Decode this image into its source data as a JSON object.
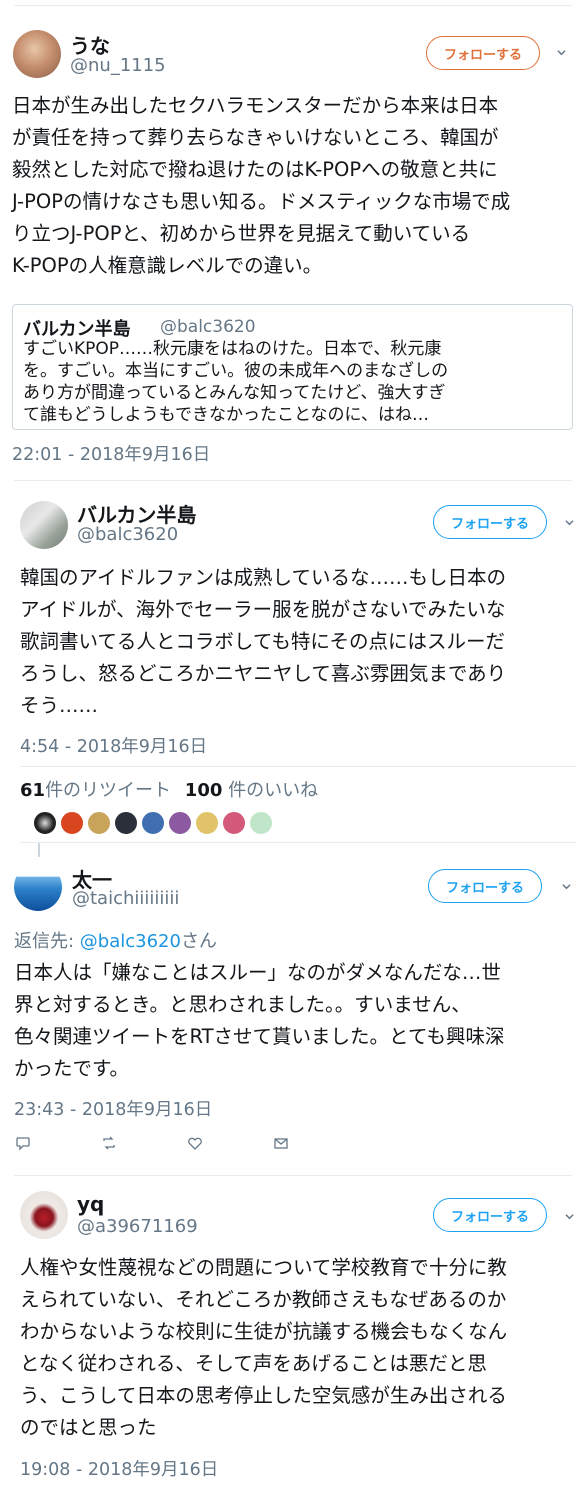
{
  "tweets": [
    {
      "name": "うな",
      "handle": "@nu_1115",
      "follow_label": "フォローする",
      "text_lines": [
        "日本が生み出したセクハラモンスターだから本来は日本",
        "が責任を持って葬り去らなきゃいけないところ、韓国が",
        "毅然とした対応で撥ね退けたのはK-POPへの敬意と共に",
        "J-POPの情けなさも思い知る。ドメスティックな市場で成",
        "り立つJ-POPと、初めから世界を見据えて動いている",
        "K-POPの人権意識レベルでの違い。"
      ],
      "quote": {
        "name": "バルカン半島",
        "handle": "@balc3620",
        "text_lines": [
          "すごいKPOP……秋元康をはねのけた。日本で、秋元康",
          "を。すごい。本当にすごい。彼の未成年へのまなざしの",
          "あり方が間違っているとみんな知ってたけど、強大すぎ",
          "て誰もどうしようもできなかったことなのに、はね…"
        ]
      },
      "timestamp": "22:01 - 2018年9月16日"
    },
    {
      "name": "バルカン半島",
      "handle": "@balc3620",
      "follow_label": "フォローする",
      "text_lines": [
        "韓国のアイドルファンは成熟しているな……もし日本の",
        "アイドルが、海外でセーラー服を脱がさないでみたいな",
        "歌詞書いてる人とコラボしても特にその点にはスルーだ",
        "ろうし、怒るどころかニヤニヤして喜ぶ雰囲気まであり",
        "そう……"
      ],
      "timestamp": "4:54 - 2018年9月16日",
      "retweet_count": "61",
      "retweet_label": "件のリツイート",
      "like_count": "100",
      "like_label": " 件のいいね"
    },
    {
      "name": "太一",
      "handle": "@taichiiiiiiiii",
      "follow_label": "フォローする",
      "reply_prefix": "返信先: ",
      "reply_handle": "@balc3620",
      "reply_suffix": "さん",
      "text_lines": [
        "日本人は「嫌なことはスルー」なのがダメなんだな…世",
        "界と対するとき。と思わされました。。すいません、",
        "色々関連ツイートをRTさせて貰いました。とても興味深",
        "かったです。"
      ],
      "timestamp": "23:43 - 2018年9月16日"
    },
    {
      "name": "yq",
      "handle": "@a39671169",
      "follow_label": "フォローする",
      "text_lines": [
        "人権や女性蔑視などの問題について学校教育で十分に教",
        "えられていない、それどころか教師さえもなぜあるのか",
        "わからないような校則に生徒が抗議する機会もなくなん",
        "となく従わされる、そして声をあげることは悪だと思",
        "う、こうして日本の思考停止した空気感が生み出される",
        "のではと思った"
      ],
      "timestamp": "19:08 - 2018年9月16日"
    }
  ],
  "icons": {
    "chevron": "chevron-down-icon",
    "reply": "reply-icon",
    "retweet": "retweet-icon",
    "like": "heart-icon",
    "dm": "direct-message-icon"
  },
  "colors": {
    "follow_orange": "#e0703a",
    "follow_blue": "#1da1f2",
    "link_blue": "#1b95e0",
    "muted": "#657786",
    "border": "#e6ecf0"
  }
}
